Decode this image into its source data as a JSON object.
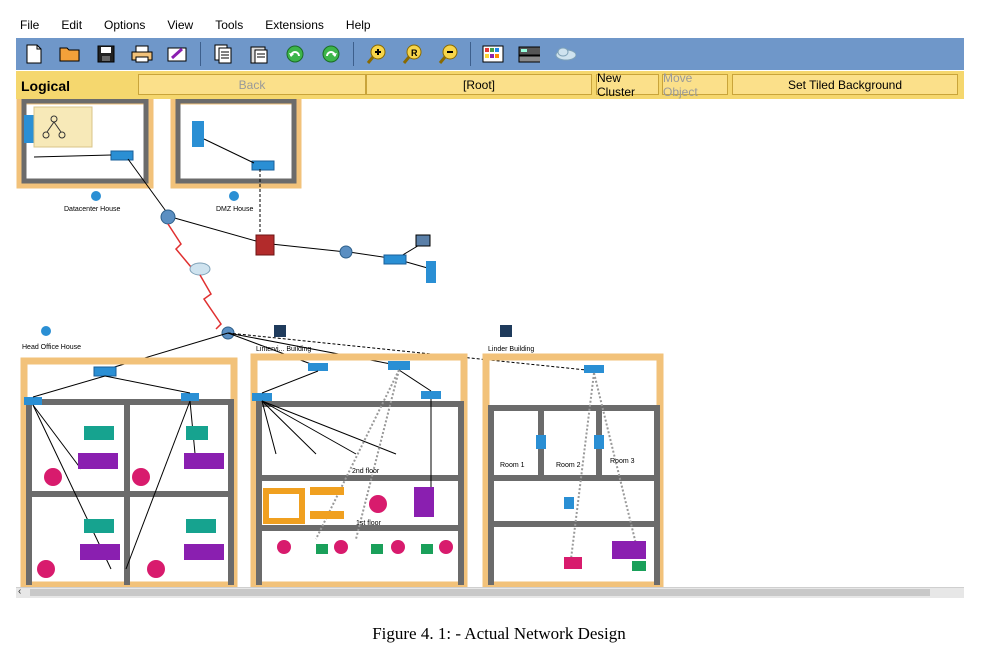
{
  "menu": [
    "File",
    "Edit",
    "Options",
    "View",
    "Tools",
    "Extensions",
    "Help"
  ],
  "toolbar_icons": [
    "new-icon",
    "open-icon",
    "save-icon",
    "print-icon",
    "activity-wizard-icon",
    "copy-icon",
    "paste-icon",
    "undo-icon",
    "redo-icon",
    "zoom-in-icon",
    "zoom-reset-icon",
    "zoom-out-icon",
    "palette-icon",
    "custom-device-icon",
    "cloud-icon"
  ],
  "nav": {
    "title": "Logical",
    "back": "Back",
    "root": "[Root]",
    "new_cluster": "New Cluster",
    "move_object": "Move Object",
    "set_tiled_background": "Set Tiled Background"
  },
  "diagram": {
    "labels": {
      "datacenter": "Datacenter House",
      "dmz": "DMZ House",
      "head_office": "Head Office House",
      "building2": "Lintervi... Building",
      "building3": "Linder Building",
      "floor1": "1st floor",
      "floor2": "2nd floor",
      "room1": "Room 1",
      "room2": "Room 2",
      "room3": "Room 3"
    }
  },
  "colors": {
    "toolbar_bg": "#6f97c9",
    "navbar_bg": "#f5d76e",
    "house_frame": "#f2c27a",
    "wall": "#6b6b6b",
    "serial_link": "#e03030",
    "room_blue": "#2a8fd4",
    "desk_purple": "#8a1fb0",
    "table_orange": "#f0a020",
    "plant_magenta": "#d81b6d",
    "chair_green": "#1aa05a"
  },
  "caption": "Figure 4. 1: - Actual Network Design"
}
